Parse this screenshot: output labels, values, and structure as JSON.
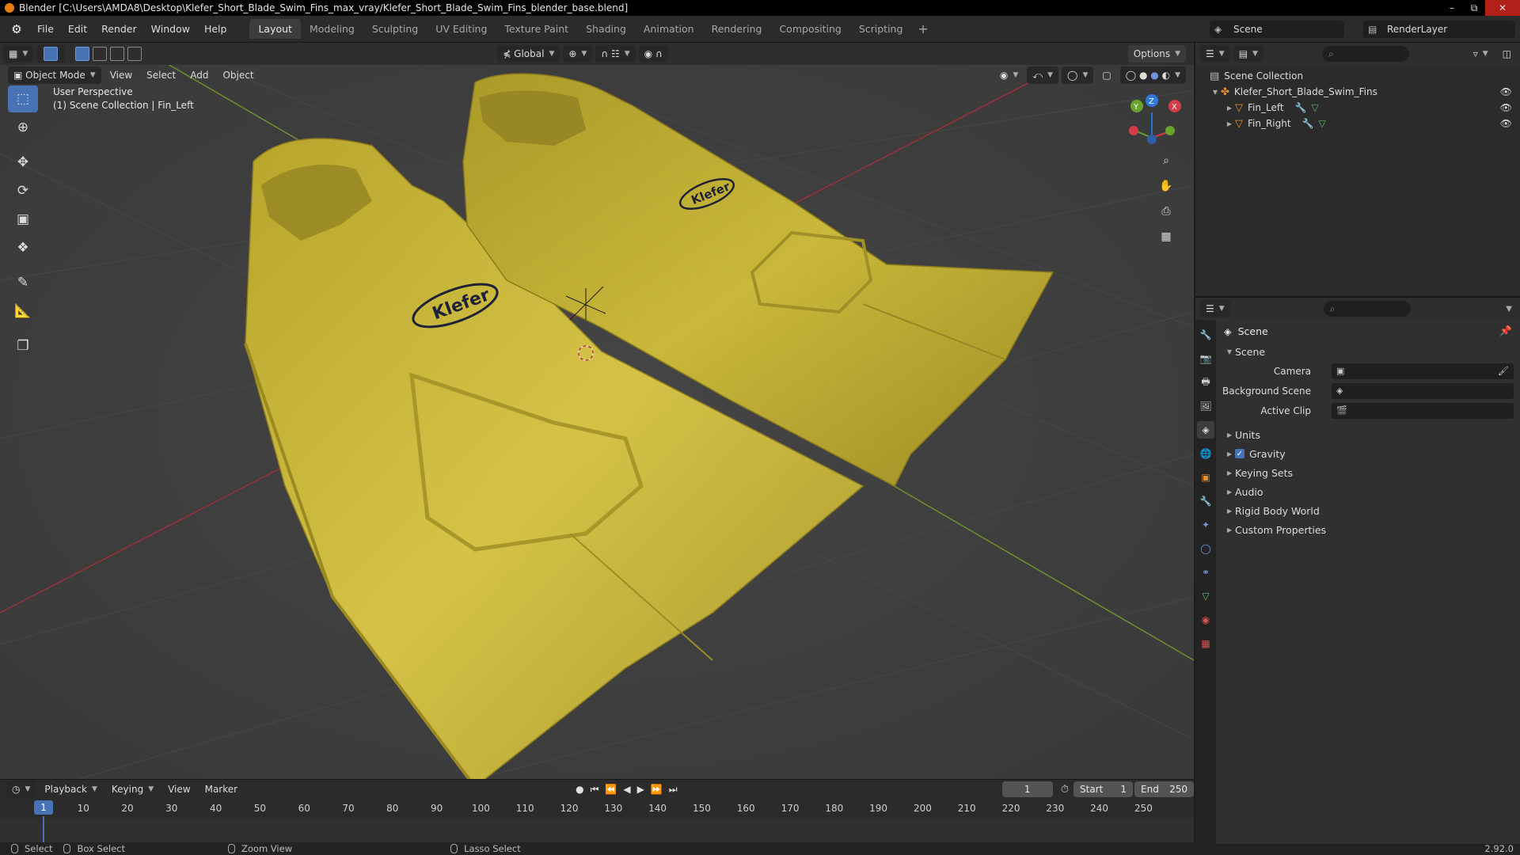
{
  "window": {
    "title": "Blender [C:\\Users\\AMDA8\\Desktop\\Klefer_Short_Blade_Swim_Fins_max_vray/Klefer_Short_Blade_Swim_Fins_blender_base.blend]",
    "minimize": "–",
    "maximize": "⧉",
    "close": "✕"
  },
  "menu": [
    "File",
    "Edit",
    "Render",
    "Window",
    "Help"
  ],
  "workspaces": [
    "Layout",
    "Modeling",
    "Sculpting",
    "UV Editing",
    "Texture Paint",
    "Shading",
    "Animation",
    "Rendering",
    "Compositing",
    "Scripting"
  ],
  "workspace_add": "+",
  "scene_selector": "Scene",
  "renderlayer_selector": "RenderLayer",
  "viewport": {
    "transform_orientation": "Global",
    "options": "Options",
    "mode": "Object Mode",
    "header_menus": [
      "View",
      "Select",
      "Add",
      "Object"
    ],
    "info_line1": "User Perspective",
    "info_line2": "(1) Scene Collection | Fin_Left",
    "logo_text": "Klefer",
    "axis_x": "X",
    "axis_y": "Y",
    "axis_z": "Z"
  },
  "timeline": {
    "menus": [
      "Playback",
      "Keying",
      "View",
      "Marker"
    ],
    "current_frame": "1",
    "start_label": "Start",
    "start_value": "1",
    "end_label": "End",
    "end_value": "250",
    "ruler": [
      "10",
      "20",
      "30",
      "40",
      "50",
      "60",
      "70",
      "80",
      "90",
      "100",
      "110",
      "120",
      "130",
      "140",
      "150",
      "160",
      "170",
      "180",
      "190",
      "200",
      "210",
      "220",
      "230",
      "240",
      "250"
    ],
    "playhead": "1"
  },
  "statusbar": {
    "select": "Select",
    "box_select": "Box Select",
    "zoom_view": "Zoom View",
    "lasso_select": "Lasso Select",
    "version": "2.92.0"
  },
  "outliner": {
    "root": "Scene Collection",
    "collection": "Klefer_Short_Blade_Swim_Fins",
    "objects": [
      "Fin_Left",
      "Fin_Right"
    ]
  },
  "properties": {
    "context": "Scene",
    "panel": "Scene",
    "fields": {
      "camera": "Camera",
      "background_scene": "Background Scene",
      "active_clip": "Active Clip"
    },
    "subpanels": [
      "Units",
      "Gravity",
      "Keying Sets",
      "Audio",
      "Rigid Body World",
      "Custom Properties"
    ],
    "gravity_checked": true
  },
  "colors": {
    "accent": "#4772b3",
    "fin": "#c9b83a",
    "viewport_bg": "#3d3d3d",
    "axis_x": "#b0383f",
    "axis_y": "#6f9d2c"
  }
}
